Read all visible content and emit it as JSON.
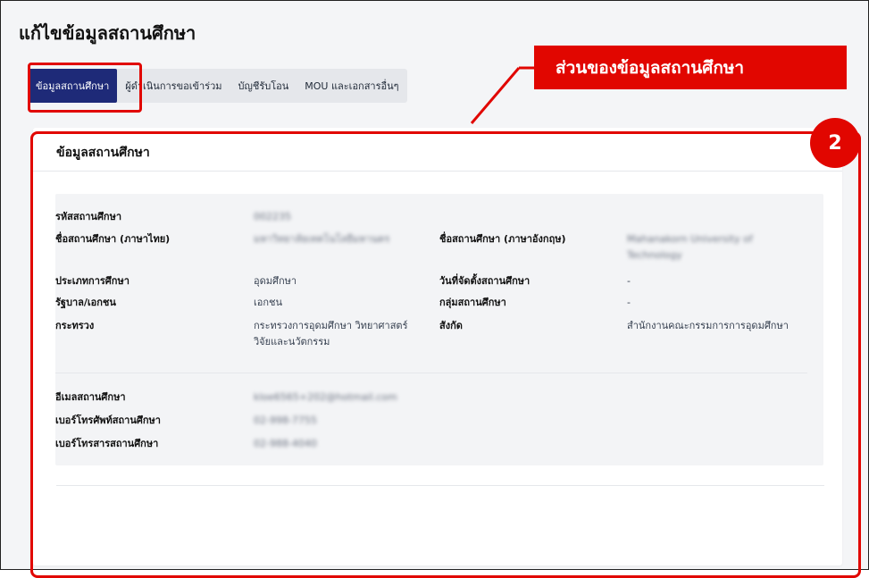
{
  "page": {
    "title": "แก้ไขข้อมูลสถานศึกษา"
  },
  "tabs": [
    {
      "label": "ข้อมูลสถานศึกษา",
      "active": true
    },
    {
      "label": "ผู้ดำเนินการขอเข้าร่วม",
      "active": false
    },
    {
      "label": "บัญชีรับโอน",
      "active": false
    },
    {
      "label": "MOU และเอกสารอื่นๆ",
      "active": false
    }
  ],
  "annotation": {
    "label": "ส่วนของข้อมูลสถานศึกษา",
    "badge": "2",
    "color": "#e10600"
  },
  "card": {
    "title": "ข้อมูลสถานศึกษา",
    "fields": {
      "code_label": "รหัสสถานศึกษา",
      "code_value": "002235",
      "name_th_label": "ชื่อสถานศึกษา (ภาษาไทย)",
      "name_th_value": "มหาวิทยาลัยเทคโนโลยีมหานคร",
      "name_en_label": "ชื่อสถานศึกษา (ภาษาอังกฤษ)",
      "name_en_value_1": "Mahanakorn University of",
      "name_en_value_2": "Technology",
      "type_label": "ประเภทการศึกษา",
      "type_value": "อุดมศึกษา",
      "founded_label": "วันที่จัดตั้งสถานศึกษา",
      "founded_value": "-",
      "gov_label": "รัฐบาล/เอกชน",
      "gov_value": "เอกชน",
      "group_label": "กลุ่มสถานศึกษา",
      "group_value": "-",
      "ministry_label": "กระทรวง",
      "ministry_value_1": "กระทรวงการอุดมศึกษา วิทยาศาสตร์",
      "ministry_value_2": "วิจัยและนวัตกรรม",
      "affiliation_label": "สังกัด",
      "affiliation_value": "สำนักงานคณะกรรมการการอุดมศึกษา",
      "email_label": "อีเมลสถานศึกษา",
      "email_value": "kloe6565+202@hotmail.com",
      "phone_label": "เบอร์โทรศัพท์สถานศึกษา",
      "phone_value": "02-998-7755",
      "fax_label": "เบอร์โทรสารสถานศึกษา",
      "fax_value": "02-988-4040"
    }
  }
}
